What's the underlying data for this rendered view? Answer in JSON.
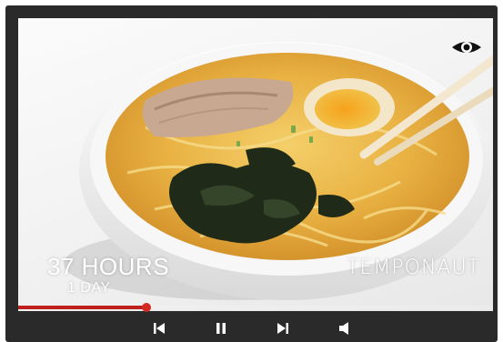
{
  "overlay": {
    "duration_primary": "37 HOURS",
    "duration_secondary": "1 DAY",
    "brand": "TEMPONAUT"
  },
  "player": {
    "progress": 0.27,
    "accent_color": "#c0201c",
    "controls": [
      {
        "name": "previous-button",
        "icon": "skip-previous-icon"
      },
      {
        "name": "pause-button",
        "icon": "pause-icon"
      },
      {
        "name": "next-button",
        "icon": "skip-next-icon"
      },
      {
        "name": "volume-button",
        "icon": "volume-icon"
      }
    ]
  }
}
